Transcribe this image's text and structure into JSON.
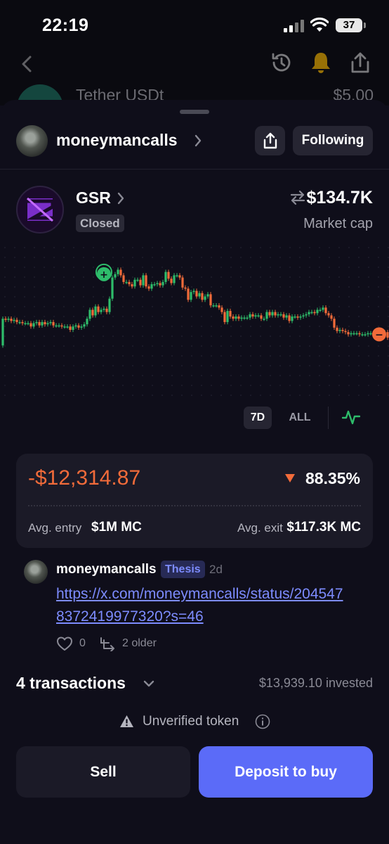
{
  "status_bar": {
    "time": "22:19",
    "battery": "37"
  },
  "background": {
    "token_name": "Tether USDt",
    "token_value": "$5.00"
  },
  "profile": {
    "username": "moneymancalls",
    "following_label": "Following"
  },
  "token": {
    "name": "GSR",
    "status": "Closed",
    "market_cap": "$134.7K",
    "market_cap_label": "Market cap"
  },
  "chart_data": {
    "type": "line",
    "x": [
      0,
      4,
      8,
      12,
      16,
      20,
      24,
      28,
      32,
      36,
      40,
      44,
      48,
      52,
      56,
      60,
      64,
      68,
      72,
      76,
      80,
      84,
      88,
      92,
      96,
      100,
      104,
      108,
      112,
      116,
      120,
      124,
      128,
      132,
      136,
      140,
      144,
      148,
      152,
      156,
      160,
      164,
      168,
      172,
      176,
      180,
      184,
      188,
      192,
      196,
      200,
      204,
      208,
      212,
      216,
      220,
      224,
      228,
      232,
      236,
      240,
      244,
      248,
      252,
      256,
      260,
      264,
      268,
      272,
      276,
      280,
      284,
      288,
      292,
      296,
      300,
      304,
      308,
      312,
      316,
      320,
      324,
      328,
      332,
      336,
      340,
      344,
      348,
      352,
      356,
      360,
      364,
      368,
      372,
      376,
      380,
      384,
      388,
      392,
      396,
      400,
      404,
      408,
      412,
      416,
      420,
      424,
      428,
      432,
      436,
      440,
      444,
      448,
      452,
      456,
      460,
      464,
      468,
      472,
      476,
      480,
      484,
      488,
      492,
      496,
      500,
      504,
      508,
      512,
      516,
      520,
      524,
      528,
      532,
      536,
      540,
      544,
      548,
      552
    ],
    "y": [
      34,
      58,
      57,
      58,
      56,
      57,
      55,
      55,
      54,
      54,
      54,
      51,
      54,
      55,
      52,
      55,
      53,
      54,
      55,
      52,
      52,
      52,
      51,
      51,
      51,
      48,
      51,
      52,
      50,
      51,
      53,
      58,
      66,
      61,
      69,
      64,
      66,
      67,
      64,
      76,
      95,
      98,
      102,
      97,
      91,
      91,
      89,
      87,
      93,
      93,
      88,
      97,
      87,
      85,
      89,
      89,
      90,
      88,
      91,
      100,
      94,
      90,
      97,
      97,
      95,
      86,
      85,
      75,
      82,
      83,
      78,
      81,
      75,
      78,
      80,
      70,
      70,
      70,
      68,
      64,
      55,
      65,
      60,
      58,
      60,
      58,
      59,
      59,
      59,
      62,
      60,
      61,
      61,
      58,
      58,
      64,
      61,
      64,
      61,
      62,
      62,
      59,
      61,
      56,
      60,
      60,
      59,
      60,
      61,
      62,
      64,
      64,
      63,
      66,
      66,
      68,
      63,
      61,
      58,
      50,
      47,
      48,
      47,
      46,
      44,
      45,
      45,
      45,
      44,
      44,
      44,
      45,
      45,
      44,
      44,
      44,
      46,
      46,
      41
    ],
    "ylim": [
      0,
      120
    ],
    "markers": [
      {
        "type": "buy",
        "label": "+",
        "x": 148,
        "y": 98
      },
      {
        "type": "sell",
        "label": "−",
        "x": 540,
        "y": 44
      }
    ],
    "colors": {
      "up": "#2ebd6b",
      "down": "#f26b3a"
    }
  },
  "ranges": {
    "selected": "7D",
    "other": "ALL"
  },
  "pnl": {
    "value": "-$12,314.87",
    "percent": "88.35%",
    "avg_entry_label": "Avg. entry",
    "avg_entry_value": "$1M MC",
    "avg_exit_label": "Avg. exit",
    "avg_exit_value": "$117.3K MC"
  },
  "post": {
    "username": "moneymancalls",
    "badge": "Thesis",
    "age": "2d",
    "link": "https://x.com/moneymancalls/status/2045478372419977320?s=46",
    "likes": "0",
    "older": "2 older"
  },
  "transactions": {
    "title": "4 transactions",
    "invested": "$13,939.10 invested"
  },
  "warning": {
    "text": "Unverified token"
  },
  "actions": {
    "sell": "Sell",
    "deposit": "Deposit to buy"
  },
  "colors": {
    "accent": "#5b6bf8",
    "loss": "#f26b3a",
    "gain": "#2ebd6b",
    "link": "#7d8cff"
  }
}
